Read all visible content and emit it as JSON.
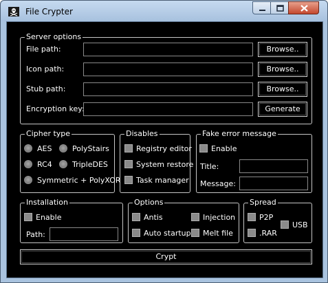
{
  "window": {
    "title": "File Crypter"
  },
  "server_options": {
    "legend": "Server options",
    "file_path_label": "File path:",
    "icon_path_label": "Icon path:",
    "stub_path_label": "Stub path:",
    "encryption_key_label": "Encryption key:",
    "file_path_value": "",
    "icon_path_value": "",
    "stub_path_value": "",
    "encryption_key_value": "",
    "browse_label": "Browse..",
    "generate_label": "Generate"
  },
  "cipher_type": {
    "legend": "Cipher type",
    "aes": "AES",
    "polystairs": "PolyStairs",
    "rc4": "RC4",
    "tripledes": "TripleDES",
    "symmetric": "Symmetric + PolyXOR"
  },
  "disables": {
    "legend": "Disables",
    "registry_editor": "Registry editor",
    "system_restore": "System restore",
    "task_manager": "Task manager"
  },
  "fake_error": {
    "legend": "Fake error message",
    "enable": "Enable",
    "title_label": "Title:",
    "message_label": "Message:",
    "title_value": "",
    "message_value": ""
  },
  "installation": {
    "legend": "Installation",
    "enable": "Enable",
    "path_label": "Path:",
    "path_value": ""
  },
  "options": {
    "legend": "Options",
    "antis": "Antis",
    "injection": "Injection",
    "auto_startup": "Auto startup",
    "melt_file": "Melt file"
  },
  "spread": {
    "legend": "Spread",
    "p2p": "P2P",
    "usb": "USB",
    "rar": ".RAR"
  },
  "crypt_label": "Crypt",
  "colors": {
    "client_background": "#000000",
    "frame": "#a9c3df",
    "close_button": "#c4482f"
  }
}
